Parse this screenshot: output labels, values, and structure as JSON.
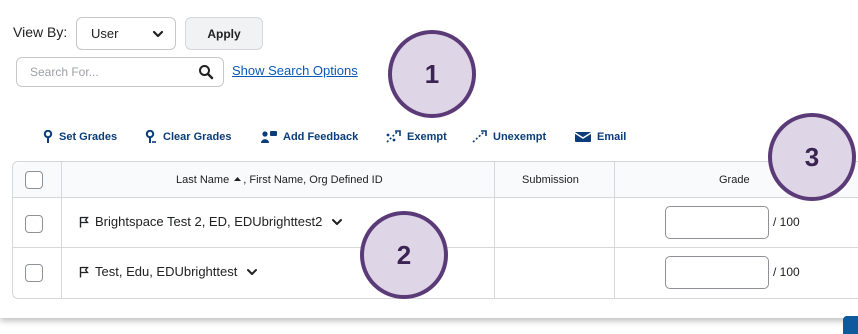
{
  "view_by": {
    "label": "View By:",
    "selected": "User",
    "apply_label": "Apply"
  },
  "search": {
    "placeholder": "Search For...",
    "options_link": "Show Search Options"
  },
  "toolbar": {
    "items": [
      {
        "label": "Set Grades",
        "icon": "pin-icon"
      },
      {
        "label": "Clear Grades",
        "icon": "pin-clear-icon"
      },
      {
        "label": "Add Feedback",
        "icon": "feedback-icon"
      },
      {
        "label": "Exempt",
        "icon": "exempt-icon"
      },
      {
        "label": "Unexempt",
        "icon": "unexempt-icon"
      },
      {
        "label": "Email",
        "icon": "email-icon"
      }
    ]
  },
  "table": {
    "headers": {
      "name": "Last Name",
      "name_rest": ", First Name, Org Defined ID",
      "submission": "Submission",
      "grade": "Grade"
    },
    "rows": [
      {
        "name": "Brightspace Test 2, ED, EDUbrighttest2",
        "grade_value": "",
        "grade_out_of": "/ 100"
      },
      {
        "name": "Test, Edu, EDUbrighttest",
        "grade_value": "",
        "grade_out_of": "/ 100"
      }
    ]
  },
  "callouts": [
    "1",
    "2",
    "3"
  ],
  "colors": {
    "link": "#0a58b5",
    "toolbar": "#0a3d7a",
    "callout_fill": "#ded6e6",
    "callout_border": "#5b3a78"
  }
}
